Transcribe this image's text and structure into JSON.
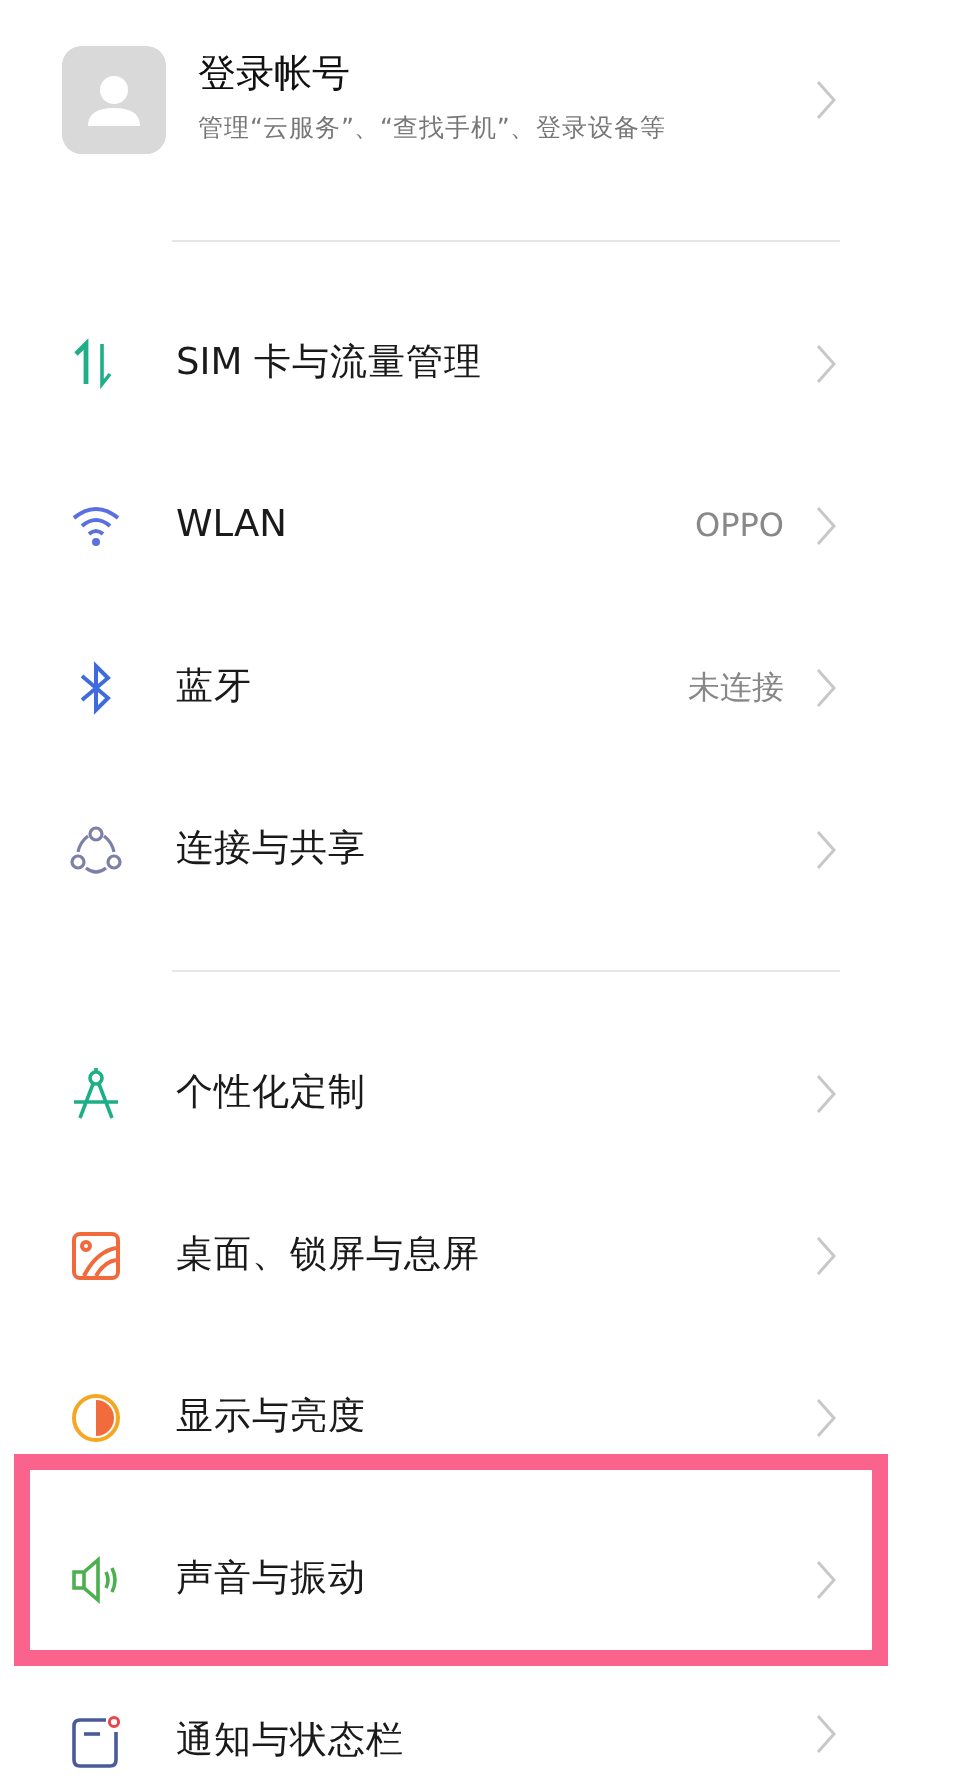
{
  "account": {
    "title": "登录帐号",
    "subtitle": "管理“云服务”、“查找手机”、登录设备等"
  },
  "groups": [
    {
      "items": [
        {
          "kind": "sim",
          "label": "SIM 卡与流量管理",
          "highlighted": false
        },
        {
          "kind": "wlan",
          "label": "WLAN",
          "value": "OPPO",
          "highlighted": false
        },
        {
          "kind": "bluetooth",
          "label": "蓝牙",
          "value": "未连接",
          "highlighted": false
        },
        {
          "kind": "share",
          "label": "连接与共享",
          "highlighted": false
        }
      ]
    },
    {
      "items": [
        {
          "kind": "personalize",
          "label": "个性化定制",
          "highlighted": false
        },
        {
          "kind": "wallpaper",
          "label": "桌面、锁屏与息屏",
          "highlighted": false
        },
        {
          "kind": "display",
          "label": "显示与亮度",
          "highlighted": false
        },
        {
          "kind": "sound",
          "label": "声音与振动",
          "highlighted": true
        },
        {
          "kind": "notify",
          "label": "通知与状态栏",
          "highlighted": false
        }
      ]
    }
  ]
}
